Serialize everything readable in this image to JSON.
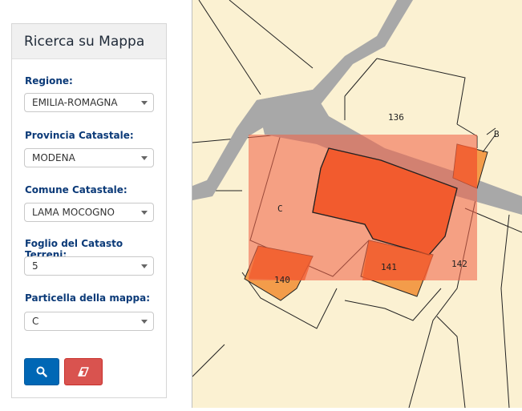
{
  "panel": {
    "title": "Ricerca su Mappa",
    "fields": [
      {
        "label": "Regione:",
        "value": "EMILIA-ROMAGNA"
      },
      {
        "label": "Provincia Catastale:",
        "value": "MODENA"
      },
      {
        "label": "Comune Catastale:",
        "value": "LAMA MOCOGNO"
      },
      {
        "label": "Foglio del Catasto Terreni:",
        "value": "5"
      },
      {
        "label": "Particella della mappa:",
        "value": "C"
      }
    ],
    "buttons": {
      "search_icon": "search-icon",
      "reset_icon": "eraser-icon"
    }
  },
  "map": {
    "parcel_labels": {
      "p136": "136",
      "pB": "B",
      "pC": "C",
      "p140": "140",
      "p141": "141",
      "p142": "142"
    },
    "colors": {
      "land": "#fbf1d2",
      "road": "#a8a8a8",
      "highlight": "#f2664a",
      "orange_fill": "#f39c4a",
      "dark_fill": "#f25a2b",
      "border": "#222222"
    }
  }
}
